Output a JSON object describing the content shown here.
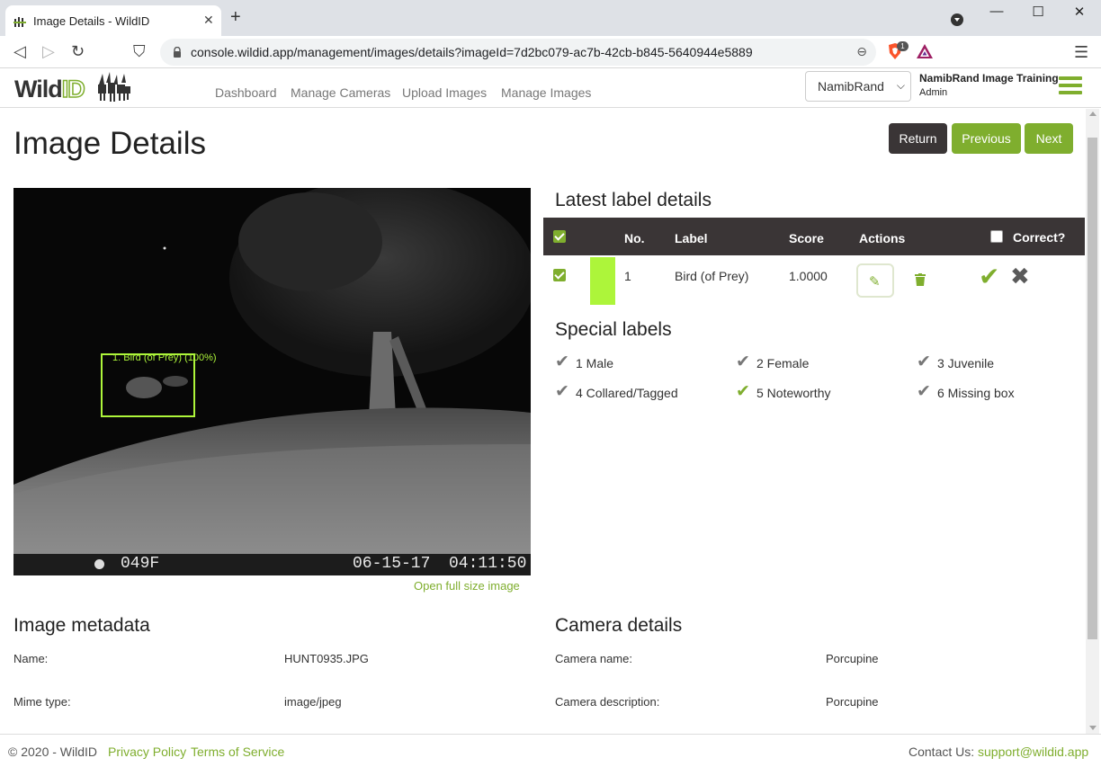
{
  "browser": {
    "tab_title": "Image Details - WildID",
    "tab_close": "✕",
    "new_tab": "+",
    "url": "console.wildid.app/management/images/details?imageId=7d2bc079-ac7b-42cb-b845-5640944e5889",
    "shield_badge": "1",
    "window_controls": {
      "minimize": "—",
      "maximize": "☐",
      "close": "✕"
    },
    "nav": {
      "back": "◁",
      "forward": "▷",
      "reload": "↻",
      "bookmark": "⛉",
      "menu": "☰",
      "zoom": "⊖"
    }
  },
  "navbar": {
    "logo": {
      "wild": "Wild",
      "id": "ID"
    },
    "links": [
      "Dashboard",
      "Manage Cameras",
      "Upload Images",
      "Manage Images"
    ],
    "organization": "NamibRand",
    "user_name": "NamibRand Image Training",
    "user_role": "Admin"
  },
  "page": {
    "title": "Image Details",
    "buttons": {
      "return": "Return",
      "previous": "Previous",
      "next": "Next"
    }
  },
  "image": {
    "camera_code": "049F",
    "date": "06-15-17",
    "time": "04:11:50",
    "bbox_label": "1. Bird (of Prey) (100%)",
    "bbox_color": "#adf53a",
    "full_size_link": "Open full size image"
  },
  "labels": {
    "title": "Latest label details",
    "columns": {
      "no": "No.",
      "label": "Label",
      "score": "Score",
      "actions": "Actions",
      "correct": "Correct?"
    },
    "rows": [
      {
        "no": "1",
        "label": "Bird (of Prey)",
        "score": "1.0000",
        "color": "#adf53a",
        "edit_icon": "✎",
        "confirm_icon": "✔",
        "reject_icon": "✖"
      }
    ]
  },
  "special_labels": {
    "title": "Special labels",
    "items": [
      {
        "text": "1 Male",
        "active": false
      },
      {
        "text": "2 Female",
        "active": false
      },
      {
        "text": "3 Juvenile",
        "active": false
      },
      {
        "text": "4 Collared/Tagged",
        "active": false
      },
      {
        "text": "5 Noteworthy",
        "active": true
      },
      {
        "text": "6 Missing box",
        "active": false
      }
    ],
    "tick_icon": "✔"
  },
  "image_metadata": {
    "title": "Image metadata",
    "rows": [
      {
        "key": "Name:",
        "value": "HUNT0935.JPG"
      },
      {
        "key": "Mime type:",
        "value": "image/jpeg"
      }
    ]
  },
  "camera_details": {
    "title": "Camera details",
    "rows": [
      {
        "key": "Camera name:",
        "value": "Porcupine"
      },
      {
        "key": "Camera description:",
        "value": "Porcupine"
      }
    ]
  },
  "footer": {
    "copyright": "© 2020 - WildID",
    "privacy": "Privacy Policy",
    "terms": "Terms of Service",
    "contact_label": "Contact Us:",
    "contact_email": "support@wildid.app"
  },
  "colors": {
    "accent": "#7fae2e",
    "dark": "#3a3536",
    "label_green": "#adf53a"
  }
}
